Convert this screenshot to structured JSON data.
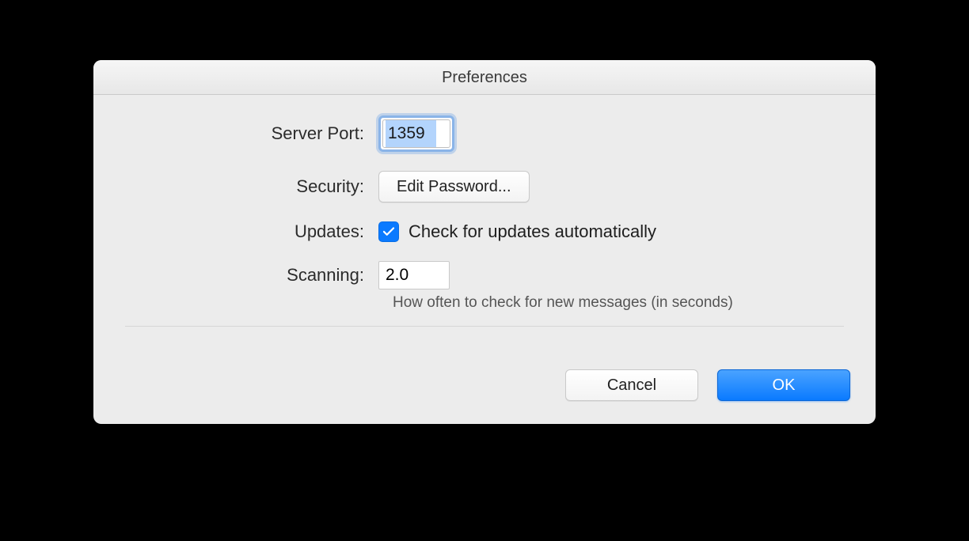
{
  "title": "Preferences",
  "labels": {
    "server_port": "Server Port:",
    "security": "Security:",
    "updates": "Updates:",
    "scanning": "Scanning:"
  },
  "server_port": {
    "value": "1359"
  },
  "security": {
    "button": "Edit Password..."
  },
  "updates": {
    "checkbox_label": "Check for updates automatically",
    "checked": true
  },
  "scanning": {
    "value": "2.0",
    "hint": "How often to check for new messages (in seconds)"
  },
  "footer": {
    "cancel": "Cancel",
    "ok": "OK"
  }
}
